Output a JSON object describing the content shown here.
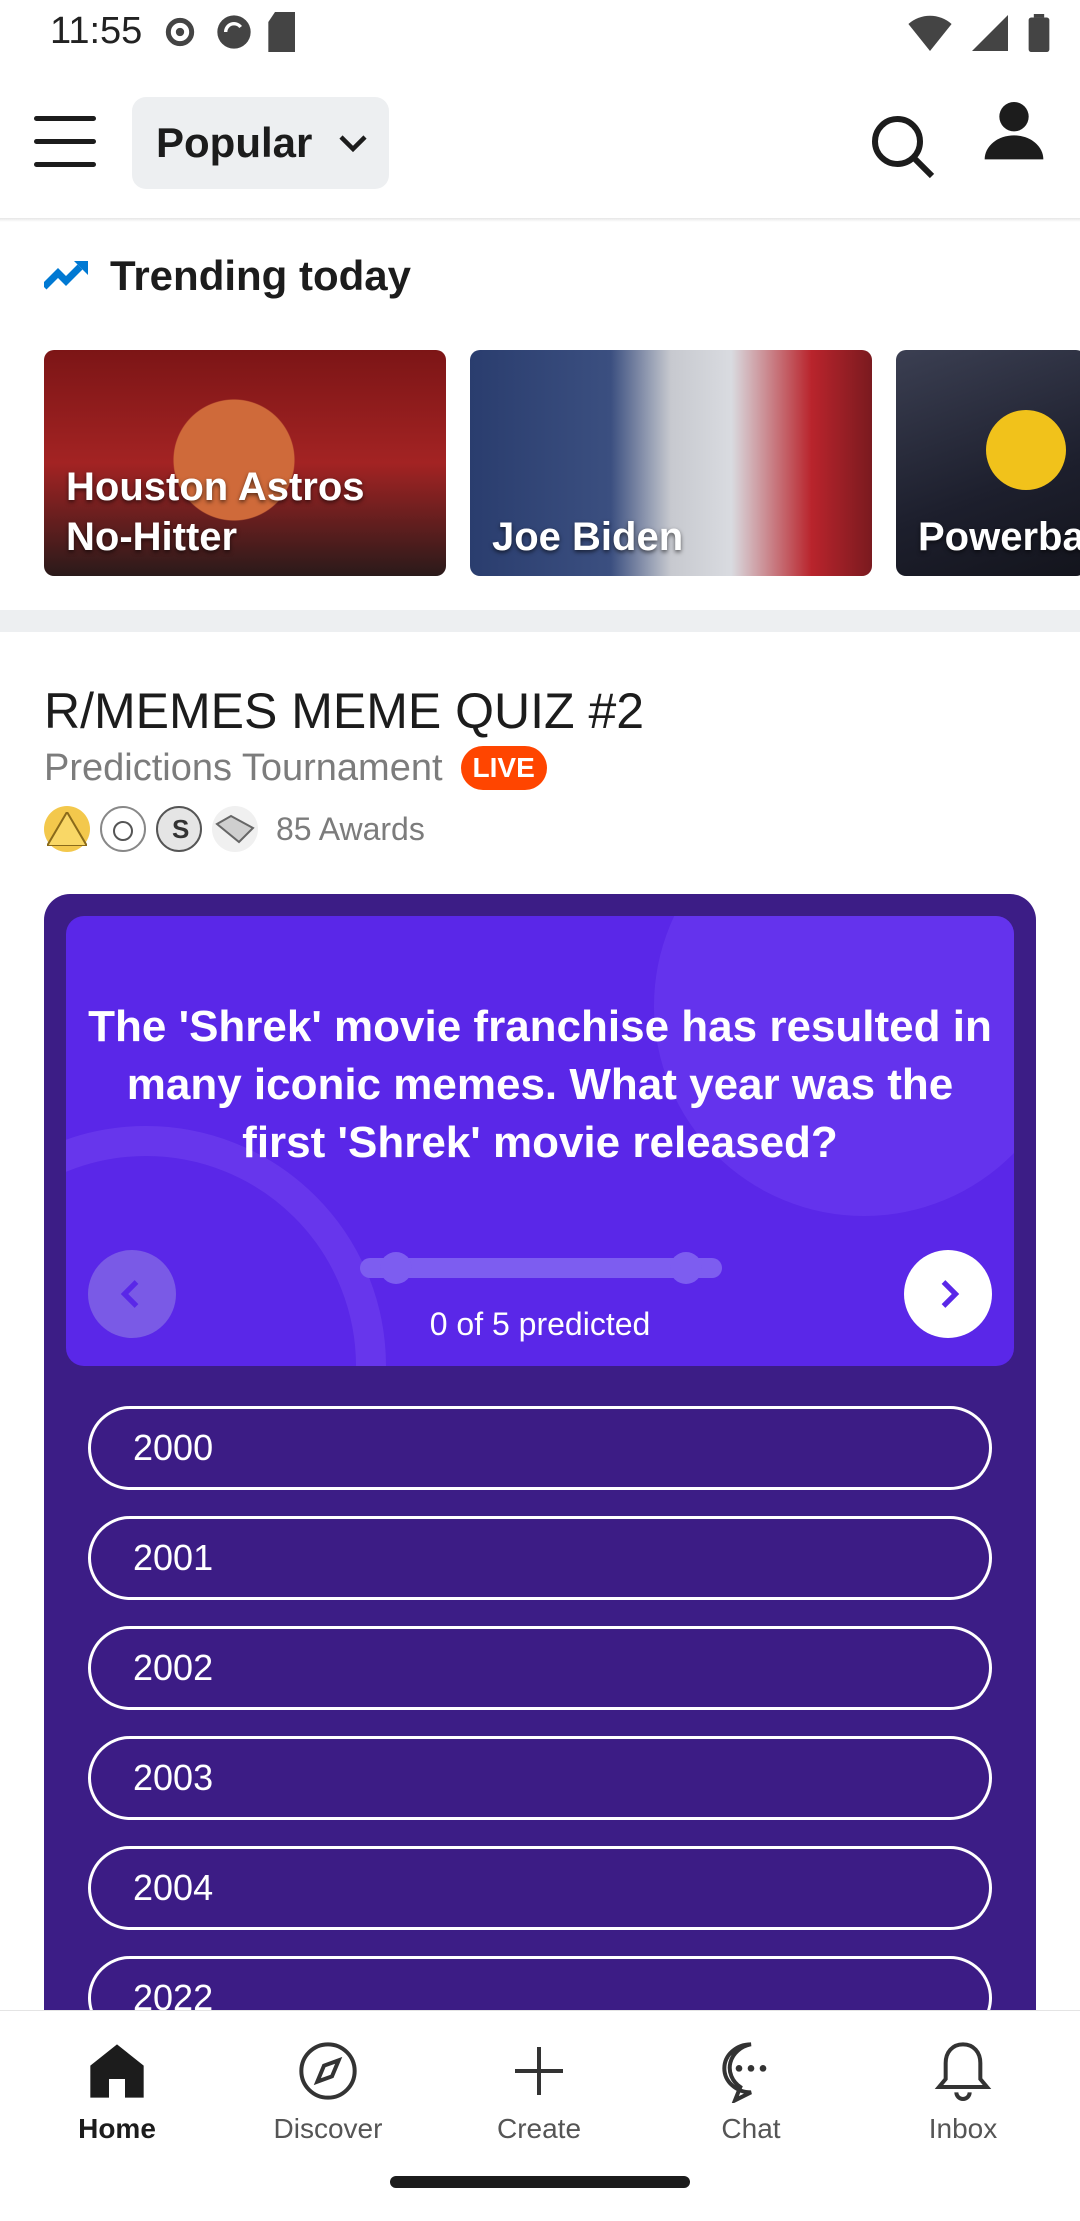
{
  "status_bar": {
    "time": "11:55",
    "icons_left": [
      "settings-icon",
      "sync-icon",
      "sd-card-icon"
    ],
    "icons_right": [
      "wifi-icon",
      "signal-icon",
      "battery-icon"
    ]
  },
  "header": {
    "feed_label": "Popular",
    "icons": [
      "menu-icon",
      "chevron-down-icon",
      "search-icon",
      "profile-icon"
    ]
  },
  "trending": {
    "title": "Trending today",
    "cards": [
      {
        "label": "Houston Astros\nNo-Hitter"
      },
      {
        "label": "Joe Biden"
      },
      {
        "label": "Powerba"
      }
    ]
  },
  "post": {
    "title": "R/MEMES MEME QUIZ #2",
    "subtitle": "Predictions Tournament",
    "live_label": "LIVE",
    "awards_count": "85 Awards",
    "quiz": {
      "question": "The 'Shrek' movie franchise has resulted in many iconic memes. What year was the first 'Shrek' movie released?",
      "progress_text": "0 of 5 predicted",
      "predicted": 0,
      "total": 5,
      "options": [
        "2000",
        "2001",
        "2002",
        "2003",
        "2004",
        "2022"
      ]
    }
  },
  "bottom_nav": {
    "items": [
      {
        "label": "Home",
        "icon": "home-icon",
        "active": true
      },
      {
        "label": "Discover",
        "icon": "compass-icon",
        "active": false
      },
      {
        "label": "Create",
        "icon": "plus-icon",
        "active": false
      },
      {
        "label": "Chat",
        "icon": "chat-icon",
        "active": false
      },
      {
        "label": "Inbox",
        "icon": "bell-icon",
        "active": false
      }
    ]
  },
  "colors": {
    "live_badge": "#ff4500",
    "quiz_bg": "#3c1d86",
    "quiz_card": "#5a27e8",
    "trending_icon": "#0079d3"
  }
}
